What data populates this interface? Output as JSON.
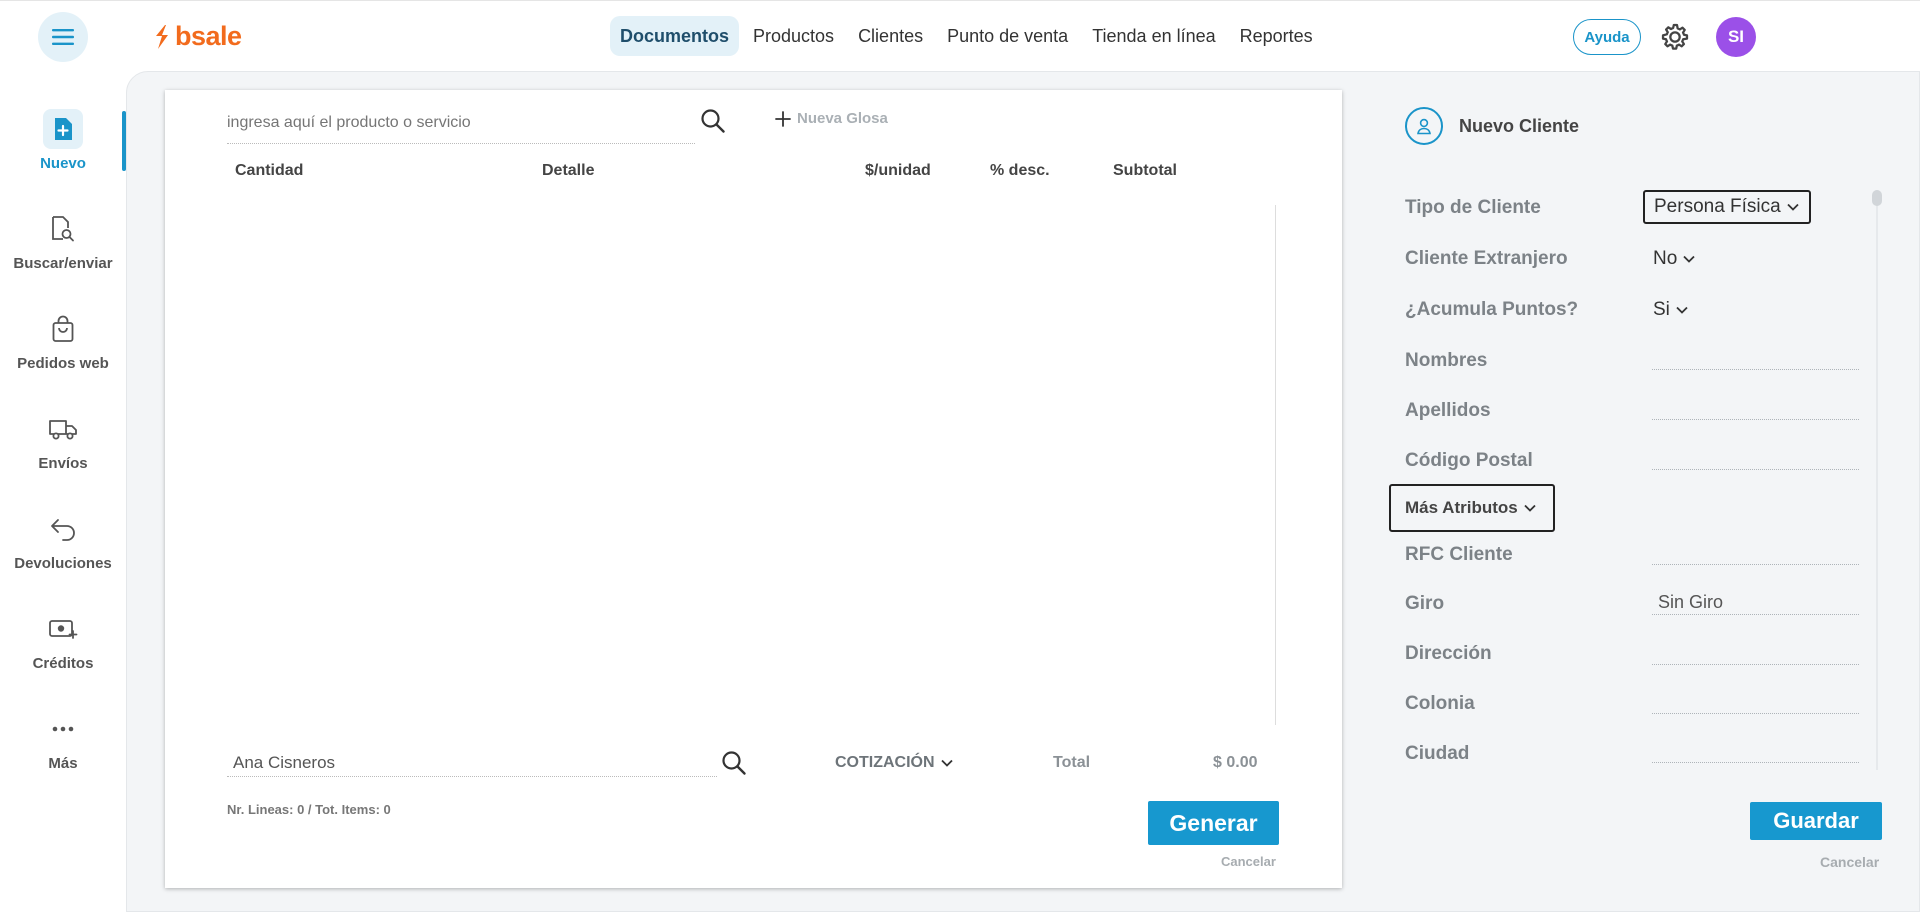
{
  "brand": {
    "name": "bsale",
    "color": "#f26b1d"
  },
  "colors": {
    "accent": "#1798cf",
    "avatar": "#9b50e8",
    "nav_active_bg": "#e3f1f8"
  },
  "topnav": {
    "items": [
      "Documentos",
      "Productos",
      "Clientes",
      "Punto de venta",
      "Tienda en línea",
      "Reportes"
    ],
    "active": "Documentos",
    "help": "Ayuda",
    "avatar_initials": "SI"
  },
  "sidebar": {
    "items": [
      {
        "label": "Nuevo",
        "icon": "new-document-icon"
      },
      {
        "label": "Buscar/enviar",
        "icon": "search-document-icon"
      },
      {
        "label": "Pedidos web",
        "icon": "shopping-bag-icon"
      },
      {
        "label": "Envíos",
        "icon": "truck-icon"
      },
      {
        "label": "Devoluciones",
        "icon": "return-arrow-icon"
      },
      {
        "label": "Créditos",
        "icon": "money-icon"
      },
      {
        "label": "Más",
        "icon": "more-dots-icon"
      }
    ]
  },
  "document": {
    "product_search_placeholder": "ingresa aquí el producto o servicio",
    "new_gloss": "Nueva Glosa",
    "columns": [
      "Cantidad",
      "Detalle",
      "$/unidad",
      "% desc.",
      "Subtotal"
    ],
    "customer": "Ana Cisneros",
    "doc_type": "COTIZACIÓN",
    "total_label": "Total",
    "total_value": "$ 0.00",
    "counts": "Nr. Lineas: 0 / Tot. Items: 0",
    "generate": "Generar",
    "cancel": "Cancelar"
  },
  "client": {
    "title": "Nuevo Cliente",
    "tipo_label": "Tipo de Cliente",
    "tipo_value": "Persona Física",
    "extranjero_label": "Cliente Extranjero",
    "extranjero_value": "No",
    "puntos_label": "¿Acumula Puntos?",
    "puntos_value": "Si",
    "nombres": "Nombres",
    "apellidos": "Apellidos",
    "codigo_postal": "Código Postal",
    "mas_atributos": "Más Atributos",
    "rfc": "RFC Cliente",
    "giro_label": "Giro",
    "giro_value": "Sin Giro",
    "direccion": "Dirección",
    "colonia": "Colonia",
    "ciudad": "Ciudad",
    "save": "Guardar",
    "cancel": "Cancelar"
  }
}
